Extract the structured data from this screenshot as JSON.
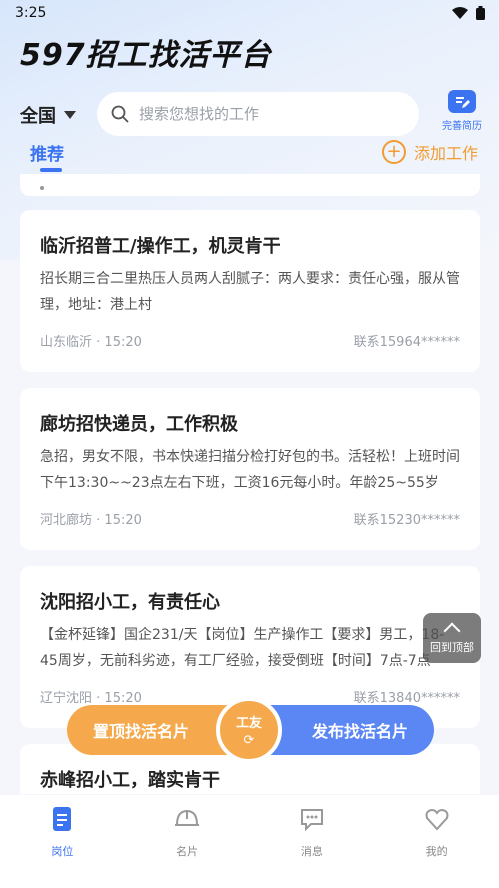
{
  "status_bar": {
    "time": "3:25"
  },
  "header": {
    "title": "597招工找活平台",
    "region": "全国",
    "search_placeholder": "搜索您想找的工作",
    "resume_label": "完善简历"
  },
  "tabs": {
    "recommend": "推荐",
    "add_job": "添加工作"
  },
  "jobs": [
    {
      "title": "临沂招普工/操作工，机灵肯干",
      "desc": "招长期三合二里热压人员两人刮腻子：两人要求：责任心强，服从管理，地址：港上村",
      "location": "山东临沂",
      "time": "15:20",
      "contact": "联系15964******"
    },
    {
      "title": "廊坊招快递员，工作积极",
      "desc": "急招，男女不限，书本快递扫描分检打好包的书。活轻松！上班时间下午13:30~~23点左右下班，工资16元每小时。年龄25~55岁",
      "location": "河北廊坊",
      "time": "15:20",
      "contact": "联系15230******"
    },
    {
      "title": "沈阳招小工，有责任心",
      "desc": "【金杯延锋】国企231/天【岗位】生产操作工【要求】男工，18-45周岁，无前科劣迹，有工厂经验，接受倒班【时间】7点-7点",
      "location": "辽宁沈阳",
      "time": "15:20",
      "contact": "联系13840******"
    },
    {
      "title": "赤峰招小工，踏实肯干"
    }
  ],
  "back_to_top": "回到顶部",
  "actions": {
    "left": "置顶找活名片",
    "center": "工友",
    "right": "发布找活名片"
  },
  "bottom_nav": [
    {
      "label": "岗位"
    },
    {
      "label": "名片"
    },
    {
      "label": "消息"
    },
    {
      "label": "我的"
    }
  ],
  "colors": {
    "primary": "#3b73f0",
    "accent": "#f5a94c",
    "right_button": "#5b87f4"
  }
}
